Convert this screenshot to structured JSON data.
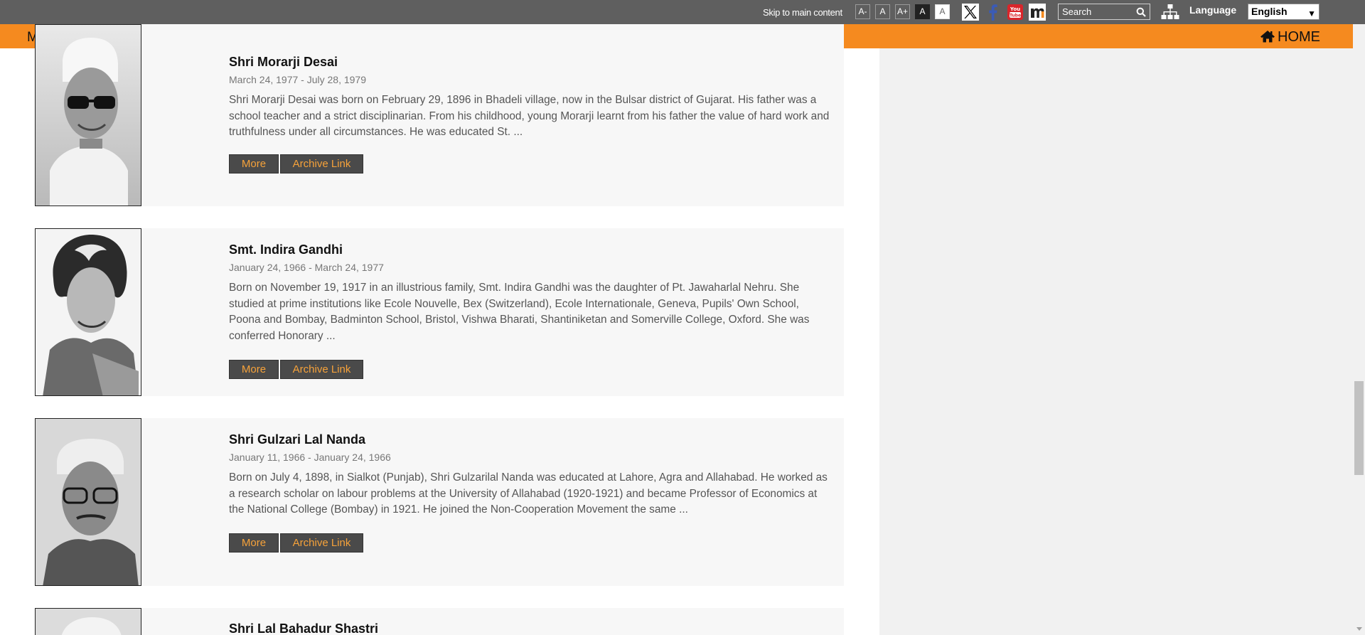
{
  "topbar": {
    "skip_link": "Skip to main content",
    "font_sizes": [
      "A-",
      "A",
      "A+",
      "A",
      "A"
    ],
    "social_icons": [
      "x-twitter-icon",
      "facebook-icon",
      "youtube-icon",
      "mygov-icon"
    ],
    "search_placeholder": "Search",
    "language_label": "Language",
    "language_value": "English"
  },
  "nav": {
    "menu_label": "MENU",
    "home_label": "HOME"
  },
  "colors": {
    "topbar": "#5f5f5f",
    "nav": "#f58a1f",
    "button_bg": "#4a4a4a",
    "button_text": "#f6a23a"
  },
  "cards": [
    {
      "name": "Shri Morarji Desai",
      "dates": "March 24, 1977 - July 28, 1979",
      "description": "Shri Morarji Desai was born on February 29, 1896 in Bhadeli village, now in the Bulsar district of Gujarat. His father was a school teacher and a strict disciplinarian. From his childhood, young Morarji learnt from his father the value of hard work and truthfulness under all circumstances. He was educated St. ...",
      "more_label": "More",
      "archive_label": "Archive Link"
    },
    {
      "name": "Smt. Indira Gandhi",
      "dates": "January 24, 1966 - March 24, 1977",
      "description": "Born on November 19, 1917 in an illustrious family, Smt. Indira Gandhi was the daughter of Pt. Jawaharlal Nehru. She studied at prime institutions like Ecole Nouvelle, Bex (Switzerland), Ecole Internationale, Geneva, Pupils' Own School, Poona and Bombay, Badminton School, Bristol, Vishwa Bharati, Shantiniketan and Somerville College, Oxford. She was conferred Honorary ...",
      "more_label": "More",
      "archive_label": "Archive Link"
    },
    {
      "name": "Shri Gulzari Lal Nanda",
      "dates": "January 11, 1966 - January 24, 1966",
      "description": "Born on July 4, 1898, in Sialkot (Punjab), Shri Gulzarilal Nanda was educated at Lahore, Agra and Allahabad. He worked as a research scholar on labour problems at the University of Allahabad (1920-1921) and became Professor of Economics at the National College (Bombay) in 1921. He joined the Non-Cooperation Movement the same ...",
      "more_label": "More",
      "archive_label": "Archive Link"
    },
    {
      "name": "Shri Lal Bahadur Shastri"
    }
  ]
}
